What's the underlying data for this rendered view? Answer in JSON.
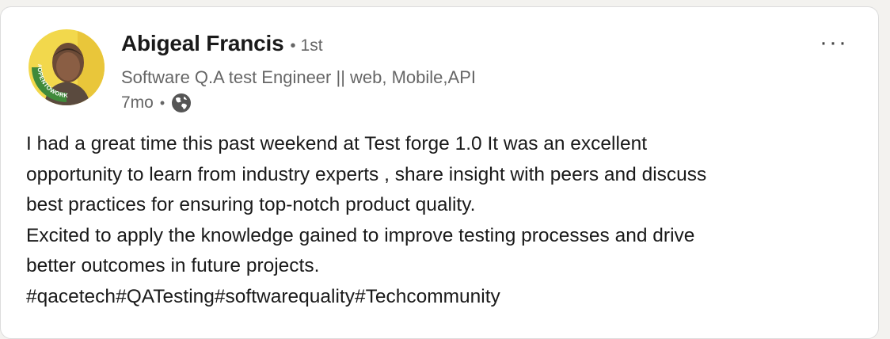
{
  "author": {
    "name": "Abigeal Francis",
    "separator": "•",
    "degree": "1st",
    "headline": "Software Q.A test Engineer || web, Mobile,API",
    "frame_text": "#OPENTOWORK"
  },
  "meta": {
    "time": "7mo",
    "separator": "•",
    "visibility_icon": "globe-icon"
  },
  "menu": {
    "more_label": "···",
    "more_icon": "ellipsis-icon"
  },
  "post": {
    "lines": [
      "I had a great time this past weekend at Test forge 1.0 It was an excellent",
      "opportunity to learn from industry experts , share insight with peers and discuss",
      "best practices for ensuring top-notch product quality.",
      "Excited to apply the knowledge gained to improve testing processes and drive",
      "better outcomes in future projects."
    ],
    "hashtags": [
      "#qacetech",
      "#QATesting",
      "#softwarequality",
      "#Techcommunity"
    ]
  },
  "colors": {
    "open_to_work_green": "#3f8a3a",
    "avatar_background": "#f2d84c",
    "text_primary": "#1a1a1a",
    "text_secondary": "#666666"
  }
}
